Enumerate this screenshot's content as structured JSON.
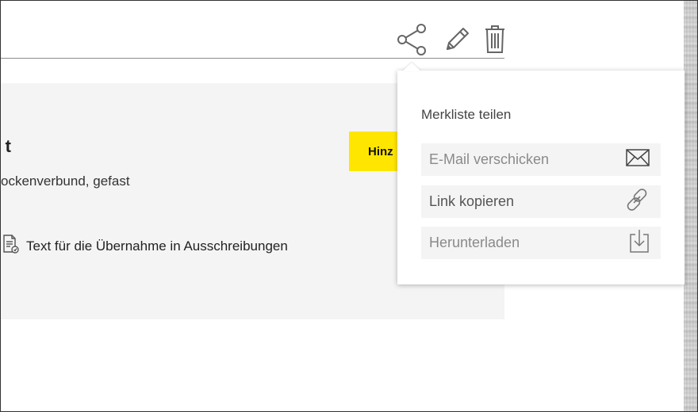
{
  "toolbar": {
    "share_icon": "share-icon",
    "edit_icon": "pencil-icon",
    "delete_icon": "trash-icon"
  },
  "card": {
    "title_partial": "t",
    "description_partial": "ockenverbund, gefast",
    "document_link_label": "Text für die Übernahme in Ausschreibungen",
    "add_button_partial": "Hinz"
  },
  "share_popup": {
    "title": "Merkliste teilen",
    "options": [
      {
        "label": "E-Mail verschicken",
        "icon": "envelope-icon"
      },
      {
        "label": "Link kopieren",
        "icon": "link-icon"
      },
      {
        "label": "Herunterladen",
        "icon": "download-icon"
      }
    ]
  },
  "colors": {
    "accent_yellow": "#ffe600",
    "card_bg": "#f4f4f4",
    "icon_gray": "#666666"
  }
}
